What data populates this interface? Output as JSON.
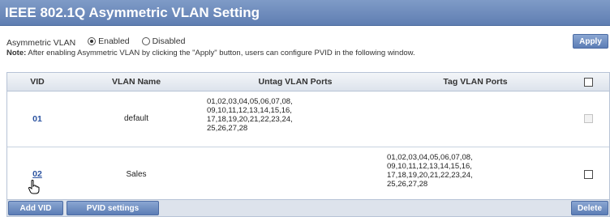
{
  "page": {
    "title": "IEEE 802.1Q Asymmetric VLAN Setting"
  },
  "asymmetric": {
    "label": "Asymmetric VLAN",
    "options": [
      {
        "label": "Enabled",
        "checked": true
      },
      {
        "label": "Disabled",
        "checked": false
      }
    ],
    "apply_label": "Apply"
  },
  "note": {
    "prefix": "Note:",
    "text": " After enabling Asymmetric VLAN by clicking the \"Apply\" button, users can configure PVID in the following window."
  },
  "table": {
    "headers": [
      "VID",
      "VLAN Name",
      "Untag VLAN Ports",
      "Tag VLAN Ports"
    ],
    "rows": [
      {
        "vid": "01",
        "name": "default",
        "untag": "01,02,03,04,05,06,07,08,\n09,10,11,12,13,14,15,16,\n17,18,19,20,21,22,23,24,\n25,26,27,28",
        "tag": "",
        "checkbox_enabled": false
      },
      {
        "vid": "02",
        "name": "Sales",
        "untag": "",
        "tag": "01,02,03,04,05,06,07,08,\n09,10,11,12,13,14,15,16,\n17,18,19,20,21,22,23,24,\n25,26,27,28",
        "checkbox_enabled": true
      }
    ]
  },
  "footer": {
    "add_vid_label": "Add VID",
    "pvid_label": "PVID settings",
    "delete_label": "Delete"
  },
  "colors": {
    "title_bar": "#6b89bd",
    "button": "#5c7db5",
    "link": "#2a52a0"
  }
}
